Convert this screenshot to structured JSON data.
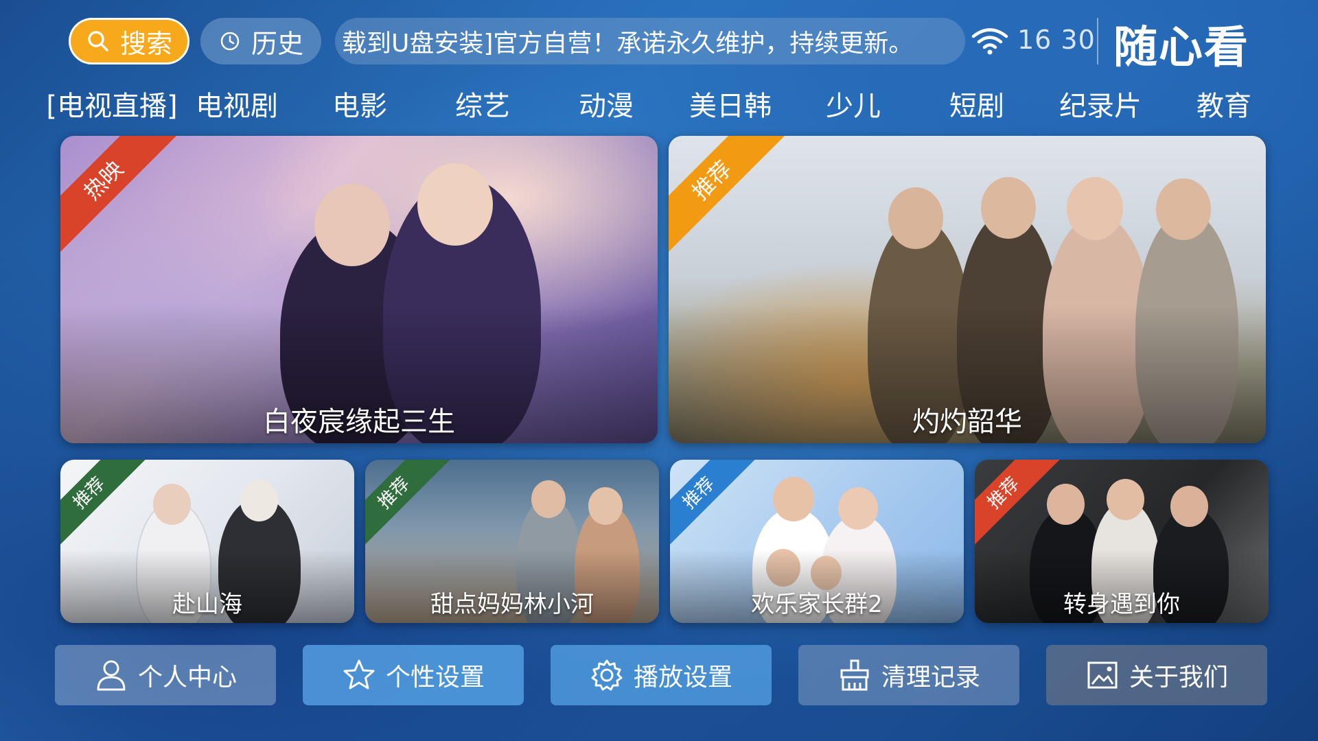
{
  "topbar": {
    "search_label": "搜索",
    "history_label": "历史",
    "marquee_text": "载到U盘安装]官方自营！承诺永久维护，持续更新。",
    "time": "16 30",
    "logo_text": "随心看",
    "search_color": "#f7a81b"
  },
  "nav": {
    "items": [
      {
        "label": "[电视直播]"
      },
      {
        "label": "电视剧"
      },
      {
        "label": "电影"
      },
      {
        "label": "综艺"
      },
      {
        "label": "动漫"
      },
      {
        "label": "美日韩"
      },
      {
        "label": "少儿"
      },
      {
        "label": "短剧"
      },
      {
        "label": "纪录片"
      },
      {
        "label": "教育"
      }
    ]
  },
  "posters": {
    "featured": [
      {
        "title": "白夜宸缘起三生",
        "tag": "热映",
        "tag_color": "#d9432a"
      },
      {
        "title": "灼灼韶华",
        "tag": "推荐",
        "tag_color": "#f29a12"
      }
    ],
    "row": [
      {
        "title": "赴山海",
        "tag": "推荐",
        "tag_color": "#2f6d3c"
      },
      {
        "title": "甜点妈妈林小河",
        "tag": "推荐",
        "tag_color": "#2f6d3c"
      },
      {
        "title": "欢乐家长群2",
        "tag": "推荐",
        "tag_color": "#2a7fd0"
      },
      {
        "title": "转身遇到你",
        "tag": "推荐",
        "tag_color": "#d9432a"
      }
    ]
  },
  "bottom": {
    "buttons": [
      {
        "label": "个人中心",
        "icon": "user-icon"
      },
      {
        "label": "个性设置",
        "icon": "star-icon"
      },
      {
        "label": "播放设置",
        "icon": "gear-icon"
      },
      {
        "label": "清理记录",
        "icon": "broom-icon"
      },
      {
        "label": "关于我们",
        "icon": "image-icon"
      }
    ]
  }
}
